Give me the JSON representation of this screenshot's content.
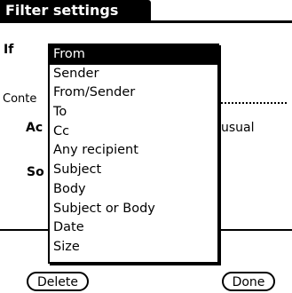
{
  "title": "Filter settings",
  "background": {
    "if_label": "If",
    "contains_partial": "Conte",
    "action_partial": "Ac",
    "usual_partial": "usual",
    "sort_partial": "So"
  },
  "popup": {
    "items": [
      "From",
      "Sender",
      "From/Sender",
      "To",
      "Cc",
      "Any recipient",
      "Subject",
      "Body",
      "Subject or Body",
      "Date",
      "Size"
    ],
    "selected": "From"
  },
  "buttons": {
    "delete": "Delete",
    "done": "Done"
  }
}
